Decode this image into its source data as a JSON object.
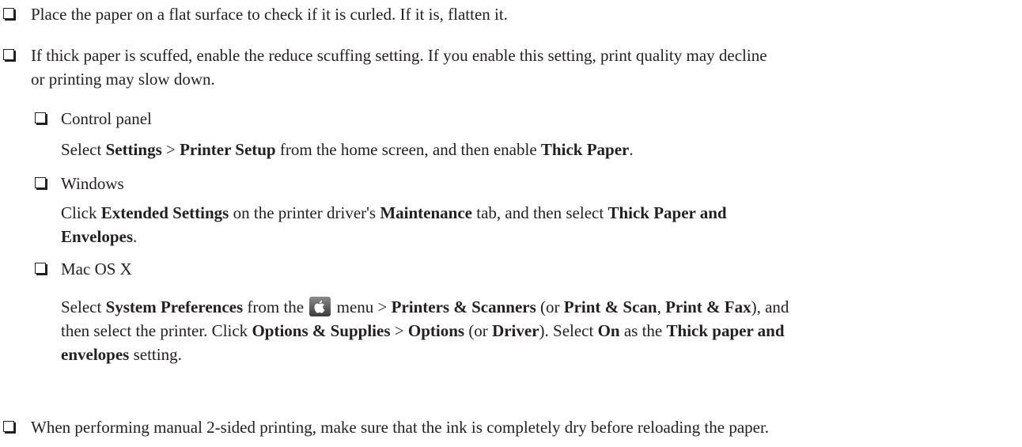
{
  "bullet1": {
    "text": "Place the paper on a flat surface to check if it is curled. If it is, flatten it."
  },
  "bullet2": {
    "line1": "If thick paper is scuffed, enable the reduce scuffing setting. If you enable this setting, print quality may decline",
    "line2": "or printing may slow down."
  },
  "control_panel": {
    "label": "Control panel",
    "p1": "Select ",
    "b1": "Settings",
    "p2": " > ",
    "b2": "Printer Setup",
    "p3": " from the home screen, and then enable ",
    "b3": "Thick Paper",
    "p4": "."
  },
  "windows": {
    "label": "Windows",
    "p1": "Click ",
    "b1": "Extended Settings",
    "p2": " on the printer driver's ",
    "b2": "Maintenance",
    "p3": " tab, and then select ",
    "b3": "Thick Paper and",
    "b3b": "Envelopes",
    "p4": "."
  },
  "mac": {
    "label": "Mac OS X",
    "l1_p1": "Select ",
    "l1_b1": "System Preferences",
    "l1_p2": " from the ",
    "l1_p3": " menu > ",
    "l1_b2": "Printers & Scanners",
    "l1_p4": " (or ",
    "l1_b3": "Print & Scan",
    "l1_p5": ", ",
    "l1_b4": "Print & Fax",
    "l1_p6": "), and",
    "l2_p1": "then select the printer. Click ",
    "l2_b1": "Options & Supplies",
    "l2_p2": " > ",
    "l2_b2": "Options",
    "l2_p3": " (or ",
    "l2_b3": "Driver",
    "l2_p4": "). Select ",
    "l2_b4": "On",
    "l2_p5": " as the ",
    "l2_b5": "Thick paper and",
    "l3_b1": "envelopes",
    "l3_p1": " setting.",
    "icon": "apple-menu-icon"
  },
  "bullet3": {
    "text": "When performing manual 2-sided printing, make sure that the ink is completely dry before reloading the paper."
  }
}
